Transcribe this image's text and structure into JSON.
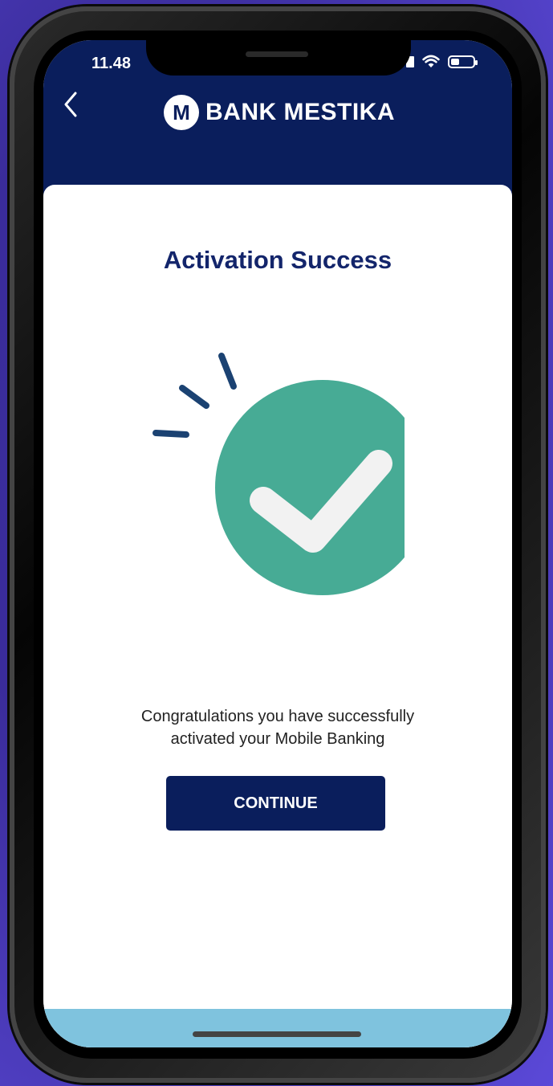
{
  "status_bar": {
    "time": "11.48"
  },
  "header": {
    "brand_name": "BANK MESTIKA",
    "logo_letter": "M"
  },
  "main": {
    "title": "Activation Success",
    "message_line1": "Congratulations you have successfully",
    "message_line2": "activated your Mobile Banking",
    "continue_label": "CONTINUE"
  },
  "icons": {
    "back": "chevron-left-icon",
    "success": "checkmark-circle-icon",
    "wifi": "wifi-icon",
    "battery": "battery-icon"
  },
  "colors": {
    "brand_navy": "#0a1e5c",
    "success_green": "#47ab95",
    "accent_lightblue": "#7fc3de"
  }
}
